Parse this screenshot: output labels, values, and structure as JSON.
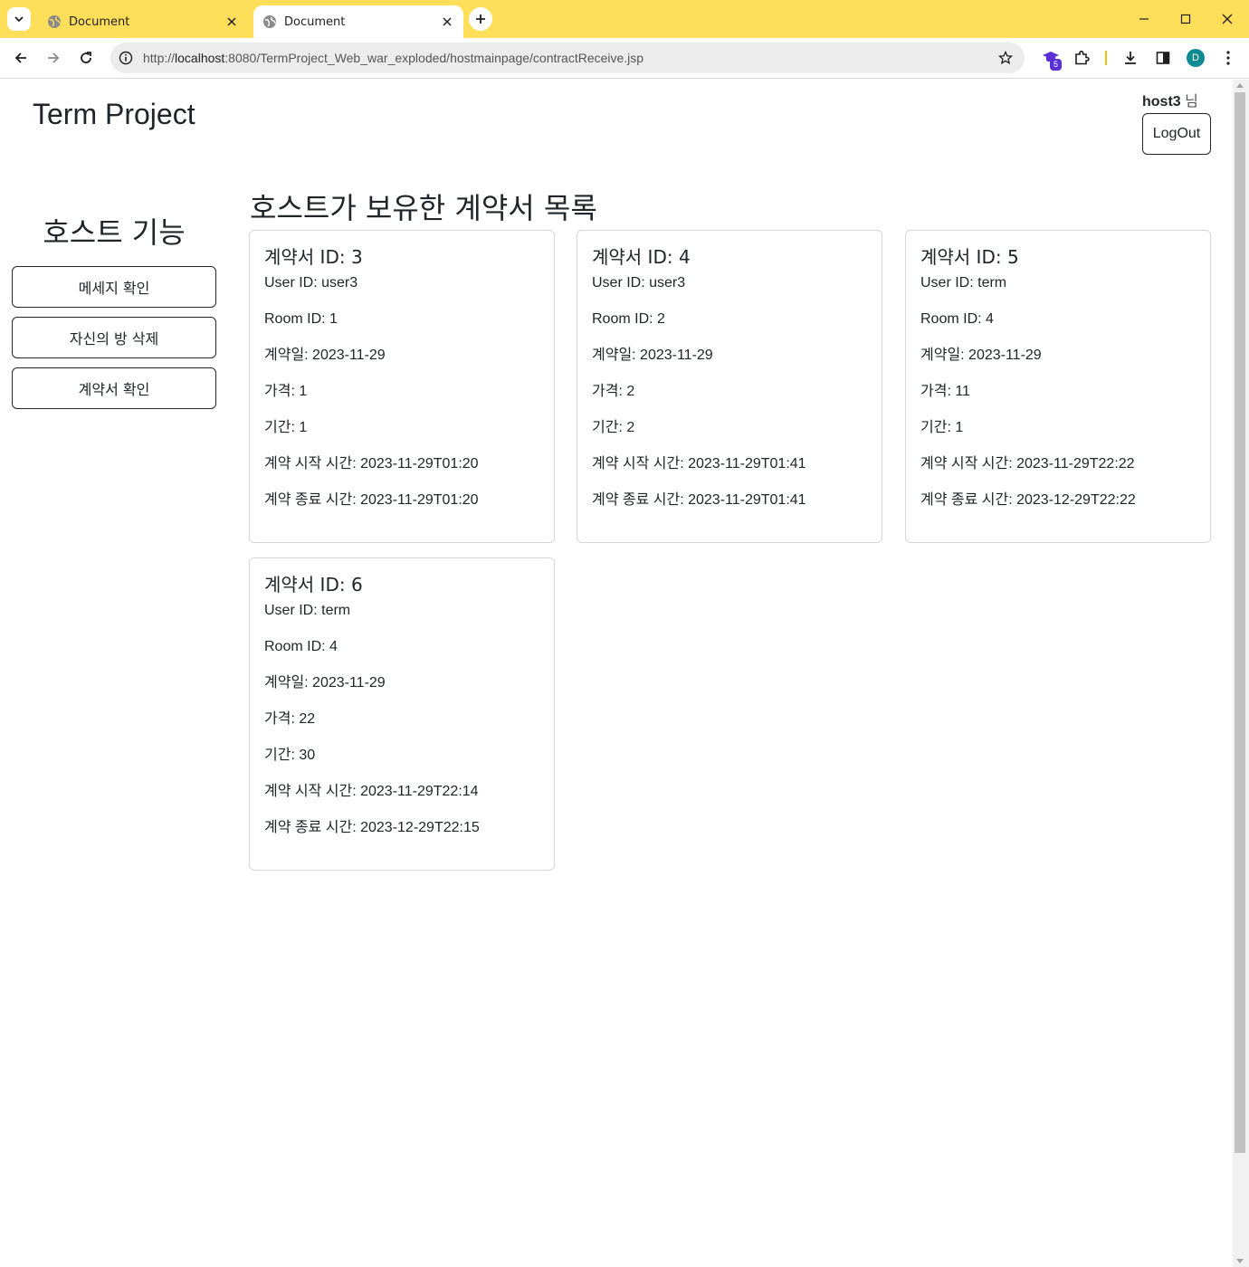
{
  "browser": {
    "tabs": [
      {
        "title": "Document",
        "active": false
      },
      {
        "title": "Document",
        "active": true
      }
    ],
    "url_prefix": "http://",
    "url_host": "localhost",
    "url_rest": ":8080/TermProject_Web_war_exploded/hostmainpage/contractReceive.jsp",
    "extension_badge": "5",
    "profile_initial": "D",
    "accent_color": "#ffde5a"
  },
  "header": {
    "site_title": "Term Project",
    "username": "host3",
    "user_suffix": " 님",
    "logout_label": "LogOut"
  },
  "sidebar": {
    "heading": "호스트 기능",
    "buttons": [
      {
        "label": "메세지 확인"
      },
      {
        "label": "자신의 방 삭제"
      },
      {
        "label": "계약서 확인"
      }
    ]
  },
  "main": {
    "heading": "호스트가 보유한 계약서 목록",
    "contracts": [
      {
        "title": "계약서 ID: 3",
        "user": "User ID: user3",
        "room": "Room ID: 1",
        "date": "계약일: 2023-11-29",
        "price": "가격: 1",
        "period": "기간: 1",
        "start": "계약 시작 시간: 2023-11-29T01:20",
        "end": "계약 종료 시간: 2023-11-29T01:20"
      },
      {
        "title": "계약서 ID: 4",
        "user": "User ID: user3",
        "room": "Room ID: 2",
        "date": "계약일: 2023-11-29",
        "price": "가격: 2",
        "period": "기간: 2",
        "start": "계약 시작 시간: 2023-11-29T01:41",
        "end": "계약 종료 시간: 2023-11-29T01:41"
      },
      {
        "title": "계약서 ID: 5",
        "user": "User ID: term",
        "room": "Room ID: 4",
        "date": "계약일: 2023-11-29",
        "price": "가격: 11",
        "period": "기간: 1",
        "start": "계약 시작 시간: 2023-11-29T22:22",
        "end": "계약 종료 시간: 2023-12-29T22:22"
      },
      {
        "title": "계약서 ID: 6",
        "user": "User ID: term",
        "room": "Room ID: 4",
        "date": "계약일: 2023-11-29",
        "price": "가격: 22",
        "period": "기간: 30",
        "start": "계약 시작 시간: 2023-11-29T22:14",
        "end": "계약 종료 시간: 2023-12-29T22:15"
      }
    ]
  }
}
